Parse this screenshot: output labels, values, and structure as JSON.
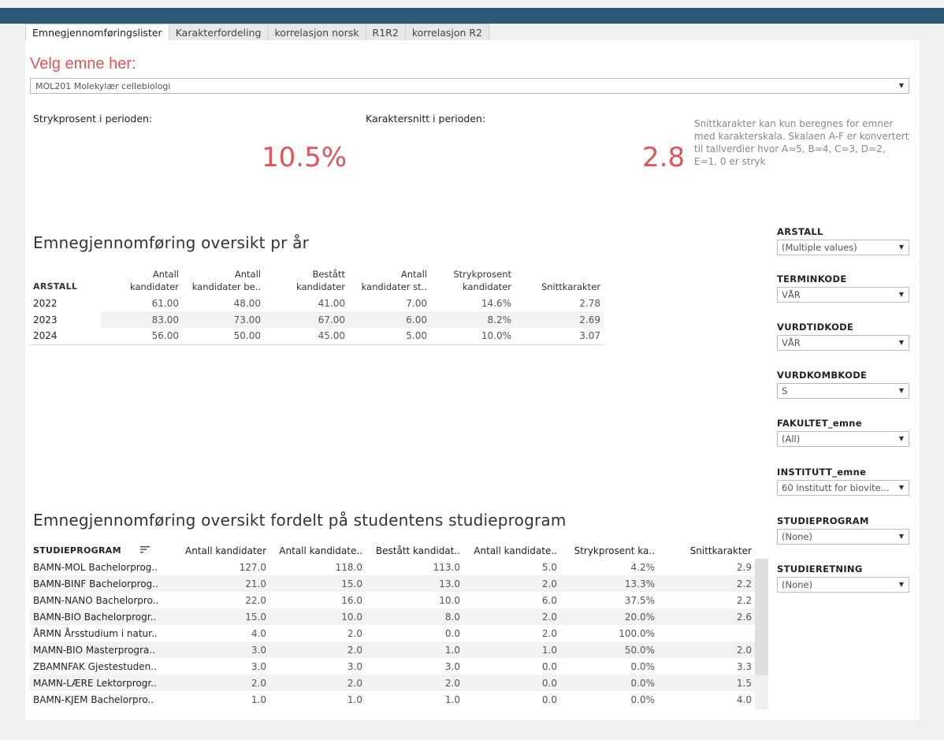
{
  "tabs": [
    "Emnegjennomføringslister",
    "Karakterfordeling",
    "korrelasjon norsk",
    "R1R2",
    "korrelasjon R2"
  ],
  "active_tab": 0,
  "select_heading": "Velg emne her:",
  "selected_course": "MOL201 Molekylær cellebiologi",
  "kpi": {
    "fail_label": "Strykprosent i perioden:",
    "fail_value": "10.5%",
    "avg_label": "Karaktersnitt i perioden:",
    "avg_value": "2.8",
    "note": "Snittkarakter kan kun beregnes for emner med karakterskala. Skalaen A-F er konvertert til tallverdier hvor A=5, B=4, C=3, D=2, E=1, 0 er stryk"
  },
  "year_table": {
    "title": "Emnegjennomføring oversikt pr år",
    "columns": [
      "ARSTALL",
      "Antall kandidater",
      "Antall kandidater be..",
      "Bestått kandidater",
      "Antall kandidater st..",
      "Strykprosent kandidater",
      "Snittkarakter"
    ],
    "rows": [
      [
        "2022",
        "61.00",
        "48.00",
        "41.00",
        "7.00",
        "14.6%",
        "2.78"
      ],
      [
        "2023",
        "83.00",
        "73.00",
        "67.00",
        "6.00",
        "8.2%",
        "2.69"
      ],
      [
        "2024",
        "56.00",
        "50.00",
        "45.00",
        "5.00",
        "10.0%",
        "3.07"
      ]
    ]
  },
  "program_table": {
    "title": "Emnegjennomføring oversikt fordelt på studentens studieprogram",
    "columns": [
      "STUDIEPROGRAM",
      "Antall kandidater",
      "Antall kandidate..",
      "Bestått kandidat..",
      "Antall kandidate..",
      "Strykprosent ka..",
      "Snittkarakter"
    ],
    "rows": [
      [
        "BAMN-MOL Bachelorprog..",
        "127.0",
        "118.0",
        "113.0",
        "5.0",
        "4.2%",
        "2.9"
      ],
      [
        "BAMN-BINF Bachelorprog..",
        "21.0",
        "15.0",
        "13.0",
        "2.0",
        "13.3%",
        "2.2"
      ],
      [
        "BAMN-NANO Bachelorpro..",
        "22.0",
        "16.0",
        "10.0",
        "6.0",
        "37.5%",
        "2.2"
      ],
      [
        "BAMN-BIO Bachelorprogr..",
        "15.0",
        "10.0",
        "8.0",
        "2.0",
        "20.0%",
        "2.6"
      ],
      [
        "ÅRMN Årsstudium i natur..",
        "4.0",
        "2.0",
        "0.0",
        "2.0",
        "100.0%",
        ""
      ],
      [
        "MAMN-BIO Masterprogra..",
        "3.0",
        "2.0",
        "1.0",
        "1.0",
        "50.0%",
        "2.0"
      ],
      [
        "ZBAMNFAK Gjestestuden..",
        "3.0",
        "3.0",
        "3.0",
        "0.0",
        "0.0%",
        "3.3"
      ],
      [
        "MAMN-LÆRE Lektorprogr..",
        "2.0",
        "2.0",
        "2.0",
        "0.0",
        "0.0%",
        "1.5"
      ],
      [
        "BAMN-KJEM Bachelorpro..",
        "1.0",
        "1.0",
        "1.0",
        "0.0",
        "0.0%",
        "4.0"
      ]
    ]
  },
  "filters": [
    {
      "label": "ARSTALL",
      "value": "(Multiple values)"
    },
    {
      "label": "TERMINKODE",
      "value": "VÅR"
    },
    {
      "label": "VURDTIDKODE",
      "value": "VÅR"
    },
    {
      "label": "VURDKOMBKODE",
      "value": "S"
    },
    {
      "label": "FAKULTET_emne",
      "value": "(All)"
    },
    {
      "label": "INSTITUTT_emne",
      "value": "60 Institutt for biovite..."
    },
    {
      "label": "STUDIEPROGRAM",
      "value": "(None)"
    },
    {
      "label": "STUDIERETNING",
      "value": "(None)"
    }
  ],
  "colors": {
    "accent": "#e05557",
    "topbar": "#2d5876"
  }
}
